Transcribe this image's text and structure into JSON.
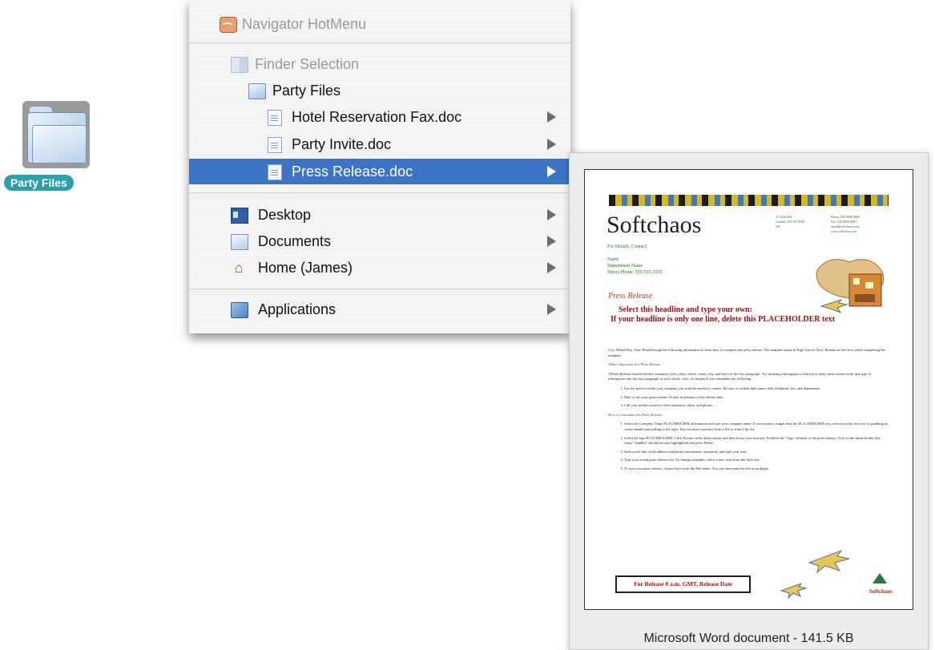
{
  "desktop": {
    "folder_label": "Party Files"
  },
  "menu": {
    "title": "Navigator HotMenu",
    "finder_selection": "Finder Selection",
    "folder": "Party Files",
    "files": [
      {
        "label": "Hotel Reservation Fax.doc",
        "selected": false
      },
      {
        "label": "Party Invite.doc",
        "selected": false
      },
      {
        "label": "Press Release.doc",
        "selected": true
      }
    ],
    "locations": [
      {
        "label": "Desktop",
        "icon": "desktop-icon"
      },
      {
        "label": "Documents",
        "icon": "documents-folder-icon"
      },
      {
        "label": "Home (James)",
        "icon": "home-icon"
      }
    ],
    "applications": "Applications"
  },
  "preview": {
    "caption": "Microsoft Word document - 141.5 KB",
    "doc": {
      "company": "Softchaos",
      "contact_left": "For Details, Contact:\n\nName\nDepartment Name\nDirect Phone: 555-555-5555",
      "contact_mid": "11 Street Rd\nLondon, UK W1 9WP\nUK",
      "contact_right": "Phone: 020 0000 0000\nFax: 020 0000 0001\nemail@softchaos.com\nwww.softchaos.com",
      "section_title": "Press Release",
      "headline_1": "Select this headline and type your own:",
      "headline_2": "If your headline is only one line, delete this PLACEHOLDER text",
      "intro": "City, Month Day, Year: Read through the following information to learn how to complete this press release. The template opens in Page Layout View. Remain in this view while completing the template.",
      "sec1_title": "What's Important in a Press Release -",
      "sec1_text": "A Press Release should identify essentials (who, what, where, when, why, and how) in the first paragraph. Try studying a newspaper to learn how fairly most writers work that type of information into the first paragraph of each article. Also, it's helpful if you remember the following:",
      "sec1_items": [
        "Use the person within your company you want the media to contact. Be sure to include their name, title, telephone, fax, and department.",
        "Mail or fax your press release 10 days in advance of the release date.",
        "Call your media contact to offer assistance, ideas, and photos."
      ],
      "sec2_title": "How to Customize this Press Release -",
      "sec2_items": [
        "Select the Company Name PLACEHOLDER information and type your company name. If your name is longer than the PLACEHOLDER text, stretch out the text box by grabbing its corner handle and pulling to the right. You can insert a picture from a file or from Clip Art.",
        "Select the logo PLACEHOLDER. Click Picture on the Insert menu, and then locate your artwork. To delete the \"logo\" element of the press release, click on the frame border (the frame \"handles\" should become highlighted) and press Delete.",
        "Select each line of the address and phone information, separately, and type your own.",
        "Type your actual press release text. To change examples, select a new style from the Style list.",
        "To save your press release, choose Save from the File menu. You can then name the file accordingly."
      ],
      "release_box": "For Release 0 a.m. GMT, Release Date",
      "brand_small": "Softchaos"
    }
  },
  "colors": {
    "selection": "#3e73c4",
    "badge": "#2aa0a8",
    "headline": "#a01010"
  }
}
